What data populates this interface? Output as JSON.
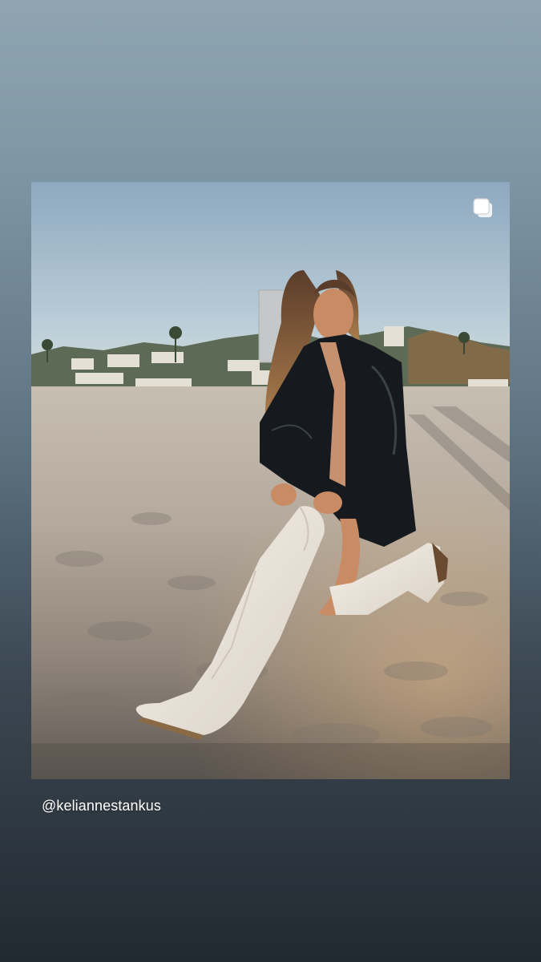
{
  "story": {
    "background_top": "#8fa5b2",
    "background_bottom": "#222930",
    "post": {
      "username": "@keliannestankus",
      "multiple_media_icon": "carousel-icon",
      "image_subject": "woman in black leather jacket and white knee-high cowboy boots kneeling on beach sand at sunset"
    }
  }
}
